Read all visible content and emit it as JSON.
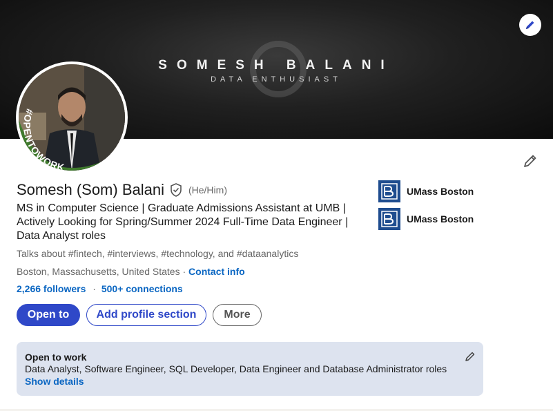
{
  "banner": {
    "name": "SOMESH BALANI",
    "subtitle": "DATA ENTHUSIAST",
    "edit_icon": "pencil-icon"
  },
  "avatar": {
    "badge_text": "#OPENTOWORK",
    "badge_color": "#3f7a2d"
  },
  "profile": {
    "name": "Somesh (Som) Balani",
    "pronouns": "(He/Him)",
    "verified_icon": "shield-check-icon",
    "headline": "MS in Computer Science | Graduate Admissions Assistant at UMB | Actively Looking for Spring/Summer 2024 Full-Time Data Engineer | Data Analyst roles",
    "talks_about": "Talks about #fintech, #interviews, #technology, and #dataanalytics",
    "location": "Boston, Massachusetts, United States",
    "location_sep": "·",
    "contact_info": "Contact info",
    "followers": "2,266 followers",
    "stats_sep": "·",
    "connections": "500+ connections",
    "edit_icon": "pencil-icon"
  },
  "education": [
    {
      "name": "UMass Boston",
      "logo_icon": "umass-boston-logo"
    },
    {
      "name": "UMass Boston",
      "logo_icon": "umass-boston-logo"
    }
  ],
  "actions": {
    "open_to": "Open to",
    "add_section": "Add profile section",
    "more": "More"
  },
  "open_to_work": {
    "title": "Open to work",
    "roles": "Data Analyst, Software Engineer, SQL Developer, Data Engineer and Database Administrator roles",
    "show_details": "Show details",
    "edit_icon": "pencil-icon"
  },
  "colors": {
    "primary": "#2f48c8",
    "link": "#0a66c2",
    "otw_bg": "#dde3ef",
    "umass_blue": "#1f4d8f"
  }
}
